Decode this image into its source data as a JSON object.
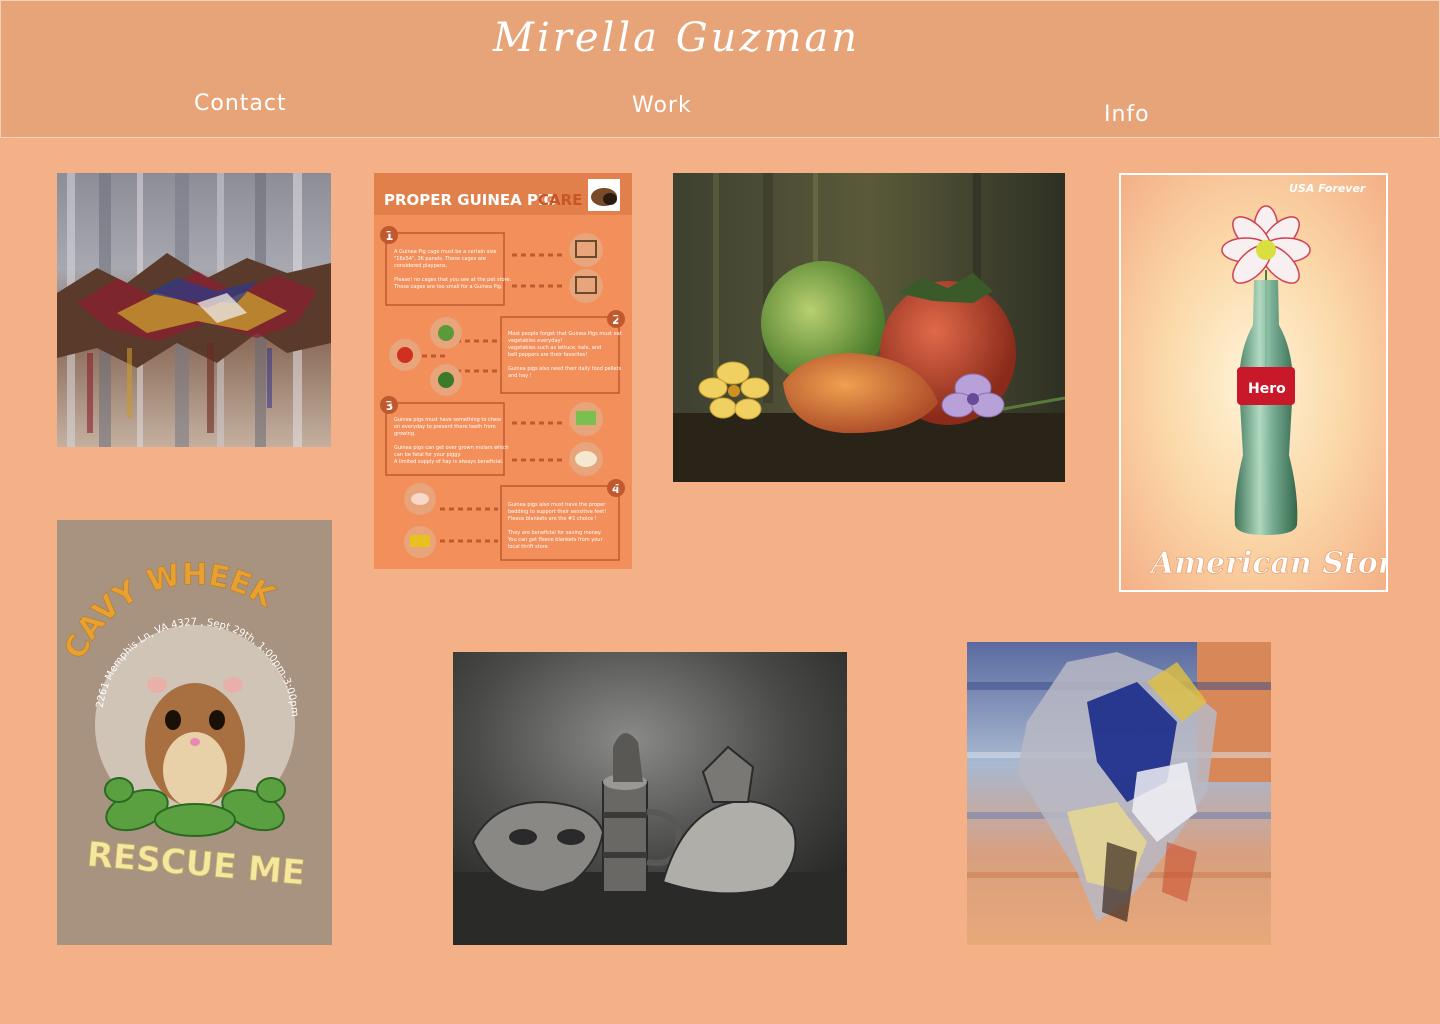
{
  "header": {
    "title": "Mirella Guzman",
    "nav": {
      "contact": "Contact",
      "work": "Work",
      "info": "Info"
    }
  },
  "gallery": {
    "guinea_pig_poster": {
      "title_part1": "PROPER GUINEA PIG",
      "title_part2": "CARE",
      "step1": [
        "A Guinea Pig cage must be a certain size",
        "\"16x54\", 36 panels. These cages are",
        "considered playpens.",
        "",
        "Please! no cages that you see at the pet store.",
        "Those cages are too small for a Guinea Pig."
      ],
      "step2": [
        "Most people forget that Guinea Pigs must eat",
        "vegetables everyday!",
        "vegetables such as lettuce, kale, and",
        "bell peppers are their favorites!",
        "",
        "Guinea pigs also need their daily food pellets",
        "and hay !"
      ],
      "step3": [
        "Guinea pigs must have something to chew",
        "on everyday to prevent there teeth from",
        "growing.",
        "",
        "Guinea pigs can get over grown molars which",
        "can be fatal for your piggy.",
        "A limited supply of hay is always beneficial."
      ],
      "step4": [
        "Guinea pigs also must have the proper",
        "bedding to support their sensitive feet!",
        "Fleece blankets are the #1 choice !",
        "",
        "They are beneficial for saving money.",
        "You can get fleece blankets from your",
        "local thrift store."
      ]
    },
    "coke_poster": {
      "tagline": "USA Forever",
      "label": "Hero",
      "caption": "American Story"
    },
    "cavy_poster": {
      "title": "CAVY WHEEK",
      "details": "2261 Memphis Ln, VA 4327    , Sept 29th, 1:00pm-3:00pm",
      "footer": "RESCUE ME"
    }
  },
  "colors": {
    "page_bg": "#f4b087",
    "header_bg": "#e8a479",
    "poster_orange": "#f28f5a",
    "cavy_bg": "#a89280"
  }
}
